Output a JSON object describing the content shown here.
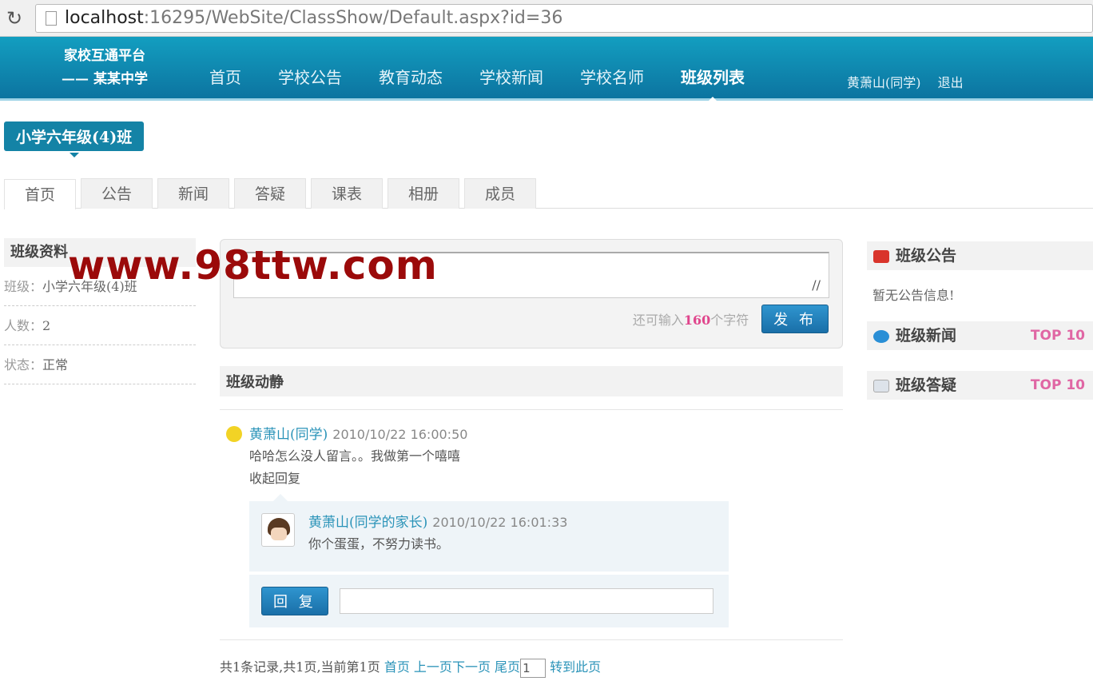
{
  "browser": {
    "url_host": "localhost",
    "url_rest": ":16295/WebSite/ClassShow/Default.aspx?id=36"
  },
  "header": {
    "logo_line1": "家校互通平台",
    "logo_line2": "—— 某某中学",
    "nav": [
      "首页",
      "学校公告",
      "教育动态",
      "学校新闻",
      "学校名师",
      "班级列表"
    ],
    "user": "黄萧山(同学)",
    "logout": "退出"
  },
  "class_name": "小学六年级(4)班",
  "tabs": [
    "首页",
    "公告",
    "新闻",
    "答疑",
    "课表",
    "相册",
    "成员"
  ],
  "left": {
    "title": "班级资料",
    "items": [
      {
        "k": "班级：",
        "v": "小学六年级(4)班"
      },
      {
        "k": "人数：",
        "v": "2"
      },
      {
        "k": "状态：",
        "v": "正常"
      }
    ]
  },
  "post": {
    "counter_prefix": "还可输入",
    "counter_value": "160",
    "counter_suffix": "个字符",
    "submit": "发 布"
  },
  "feed": {
    "title": "班级动静",
    "item": {
      "author": "黄萧山(同学)",
      "time": "2010/10/22 16:00:50",
      "content": "哈哈怎么没人留言。。我做第一个嘻嘻",
      "toggle": "收起回复"
    },
    "reply": {
      "author": "黄萧山(同学的家长)",
      "time": "2010/10/22 16:01:33",
      "content": "你个蛋蛋，不努力读书。"
    },
    "reply_button": "回 复"
  },
  "pager": {
    "summary": "共1条记录,共1页,当前第1页",
    "first": "首页",
    "prev": "上一页",
    "next": "下一页",
    "last": "尾页",
    "page_value": "1",
    "go": "转到此页"
  },
  "right": {
    "notice_title": "班级公告",
    "notice_empty": "暂无公告信息!",
    "news_title": "班级新闻",
    "qa_title": "班级答疑",
    "top": "TOP 10"
  },
  "watermark": "www.98ttw.com"
}
